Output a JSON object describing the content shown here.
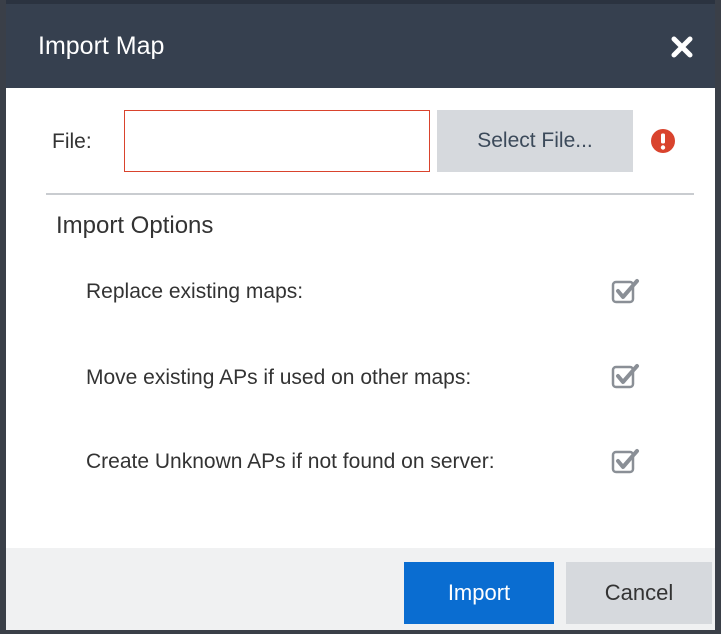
{
  "dialog": {
    "title": "Import Map",
    "close_icon": "close-icon"
  },
  "file": {
    "label": "File:",
    "value": "",
    "placeholder": "",
    "select_button_label": "Select File...",
    "error_icon": "exclamation-circle-icon",
    "error_color": "#d9432d"
  },
  "options": {
    "heading": "Import Options",
    "items": [
      {
        "label": "Replace existing maps:",
        "checked": true
      },
      {
        "label": "Move existing APs if used on other maps:",
        "checked": true
      },
      {
        "label": "Create Unknown APs if not found on server:",
        "checked": true
      }
    ]
  },
  "footer": {
    "import_label": "Import",
    "cancel_label": "Cancel"
  },
  "colors": {
    "header_bg": "#36404f",
    "primary": "#0a6dd1",
    "secondary_bg": "#d6d9dd"
  }
}
